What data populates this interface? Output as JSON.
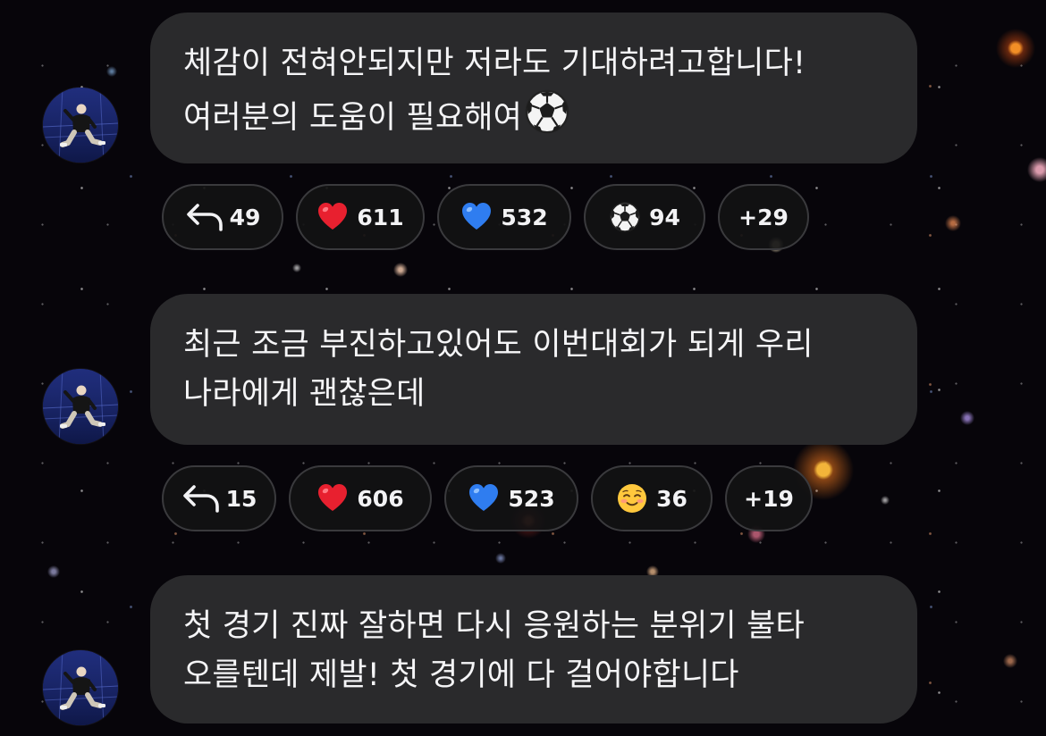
{
  "messages": [
    {
      "lines": [
        "체감이 전혀안되지만 저라도 기대하려고합니다!",
        "여러분의 도움이 필요해여"
      ],
      "trailing_emoji": "soccer-ball-icon",
      "reactions": [
        {
          "icon": "reply-arrow-icon",
          "count": "49"
        },
        {
          "icon": "red-heart-icon",
          "count": "611"
        },
        {
          "icon": "blue-heart-icon",
          "count": "532"
        },
        {
          "icon": "soccer-ball-icon",
          "count": "94"
        }
      ],
      "more_reactions": "+29"
    },
    {
      "lines": [
        "최근 조금 부진하고있어도 이번대회가 되게 우리",
        "나라에게 괜찮은데"
      ],
      "reactions": [
        {
          "icon": "reply-arrow-icon",
          "count": "15"
        },
        {
          "icon": "red-heart-icon",
          "count": "606"
        },
        {
          "icon": "blue-heart-icon",
          "count": "523"
        },
        {
          "icon": "smiling-face-icon",
          "count": "36"
        }
      ],
      "more_reactions": "+19"
    },
    {
      "lines": [
        "첫 경기 진짜 잘하면 다시 응원하는 분위기 불타",
        "오를텐데 제발! 첫 경기에 다 걸어야합니다"
      ]
    }
  ],
  "colors": {
    "bubble_background": "#2a2a2c",
    "pill_border": "#3a3a3d",
    "text": "#f5f5f7",
    "red_heart": "#e8202f",
    "blue_heart": "#2f7df0"
  }
}
